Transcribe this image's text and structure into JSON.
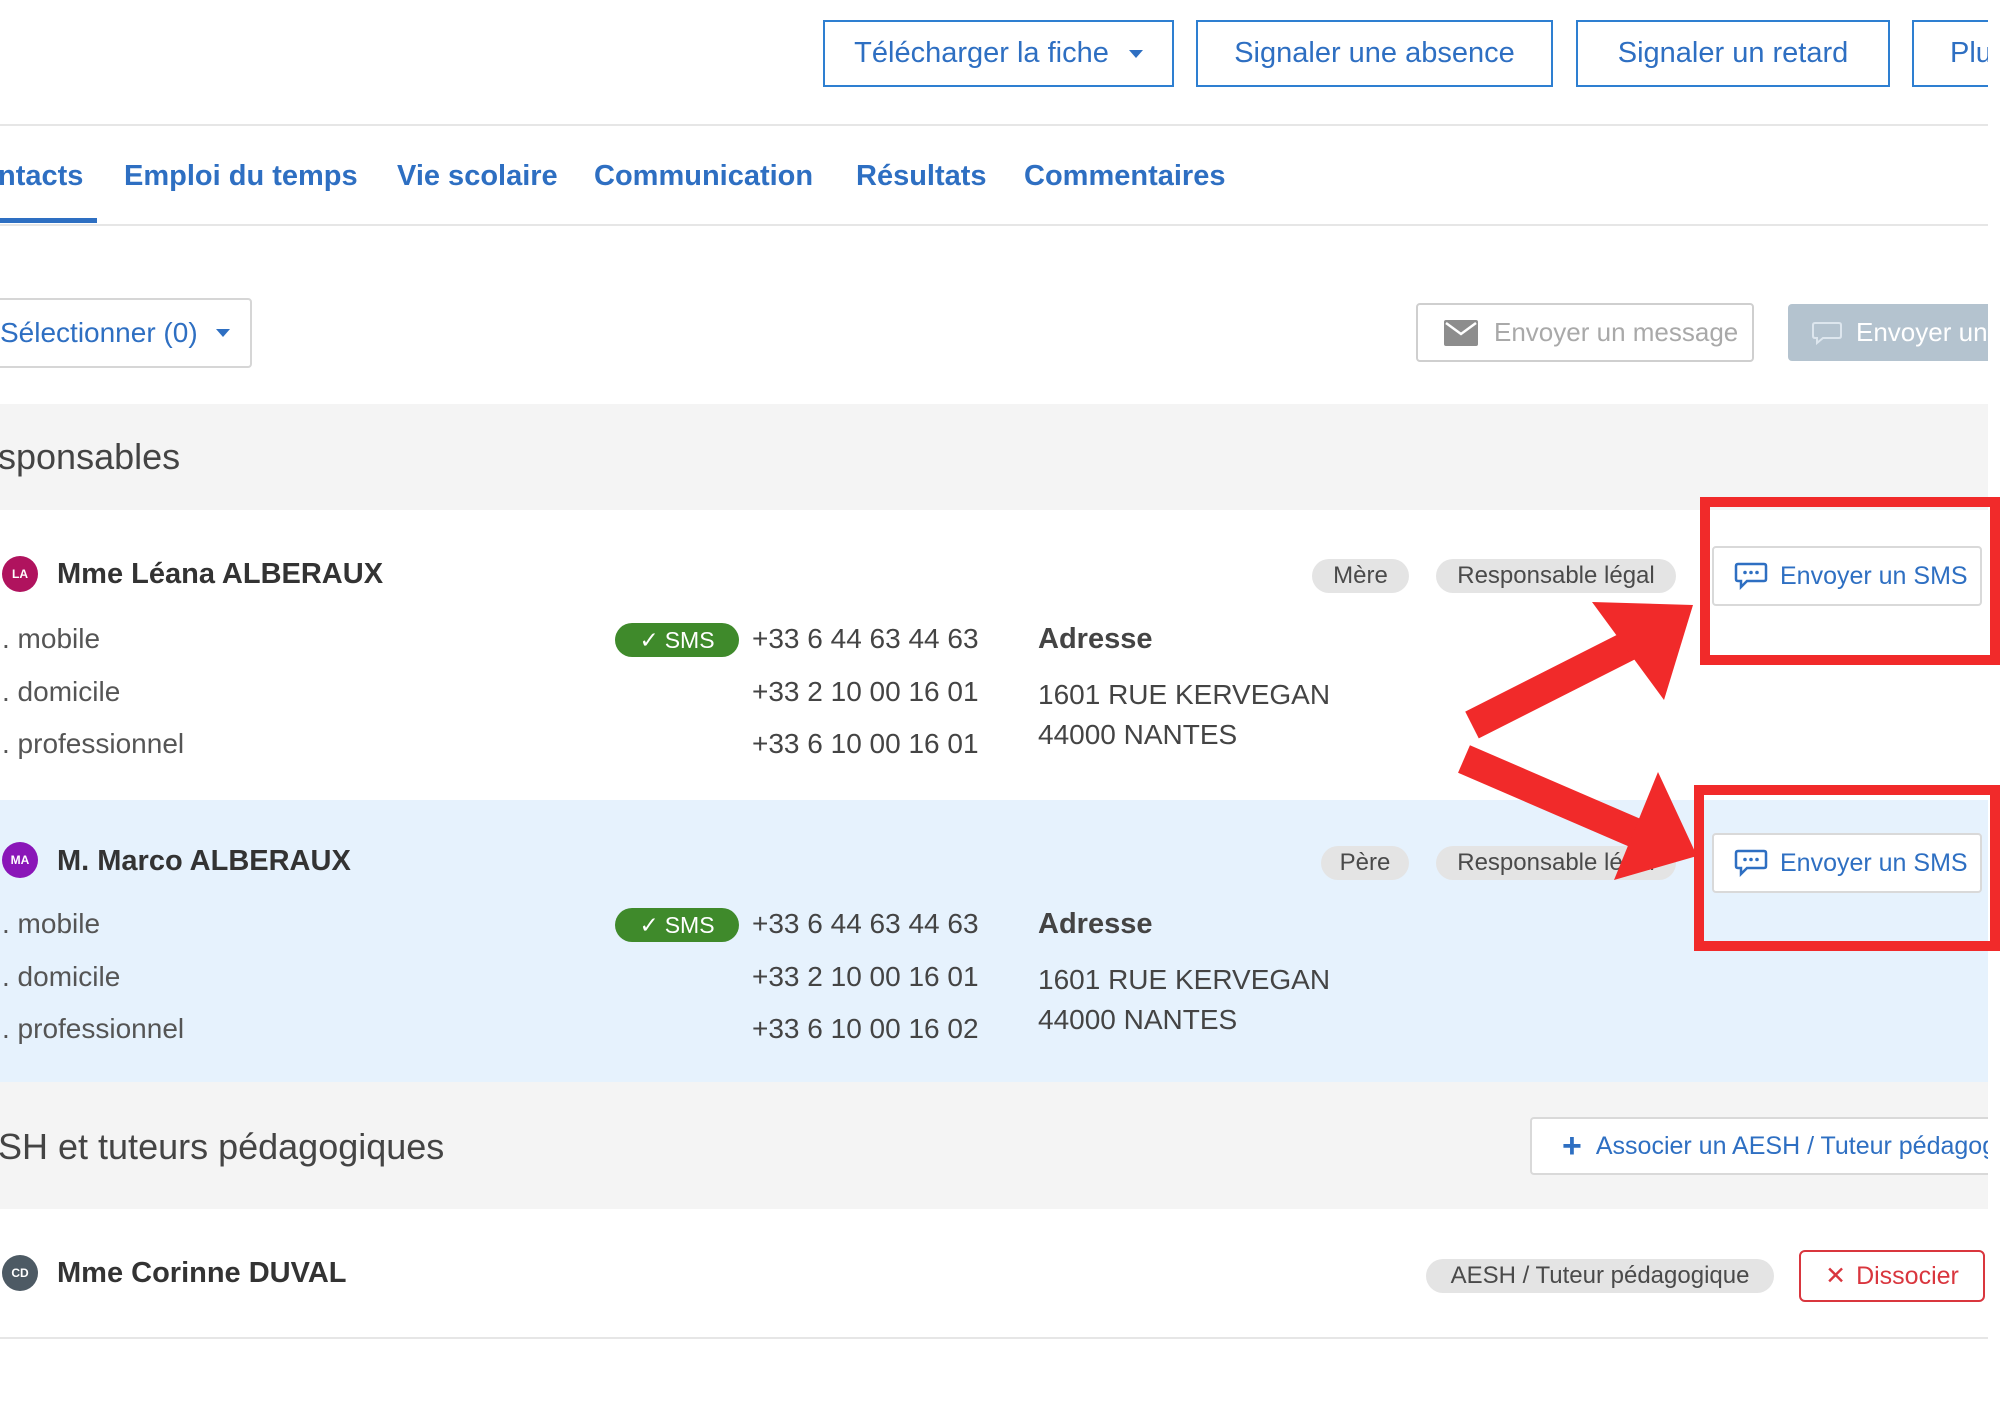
{
  "colors": {
    "accent": "#2e6fc2",
    "annotation": "#f12a2a",
    "sms_badge": "#3f8a2b",
    "danger": "#d9363e"
  },
  "header": {
    "download_label": "Télécharger la fiche",
    "absence_label": "Signaler une absence",
    "late_label": "Signaler un retard",
    "more_label": "Plu"
  },
  "tabs": [
    {
      "label": "ntacts",
      "active": true
    },
    {
      "label": "Emploi du temps"
    },
    {
      "label": "Vie scolaire"
    },
    {
      "label": "Communication"
    },
    {
      "label": "Résultats"
    },
    {
      "label": "Commentaires"
    }
  ],
  "toolbar": {
    "select_label": "Sélectionner (0)",
    "message_label": "Envoyer un message",
    "sms_bulk_label": "Envoyer un"
  },
  "responsables": {
    "title": "sponsables",
    "people": [
      {
        "initials": "LA",
        "avatar_color": "#b0135e",
        "name": "Mme Léana ALBERAUX",
        "relation": "Mère",
        "role": "Responsable légal",
        "sms_button": "Envoyer un SMS",
        "phones": [
          {
            "label": ". mobile",
            "number": "+33 6 44 63 44 63",
            "sms_badge": "SMS"
          },
          {
            "label": ". domicile",
            "number": "+33 2 10 00 16 01"
          },
          {
            "label": ". professionnel",
            "number": "+33 6 10 00 16 01"
          }
        ],
        "address_title": "Adresse",
        "address_lines": [
          "1601 RUE KERVEGAN",
          "44000 NANTES"
        ]
      },
      {
        "initials": "MA",
        "avatar_color": "#8a16b8",
        "name": "M. Marco ALBERAUX",
        "relation": "Père",
        "role": "Responsable légal",
        "sms_button": "Envoyer un SMS",
        "phones": [
          {
            "label": ". mobile",
            "number": "+33 6 44 63 44 63",
            "sms_badge": "SMS"
          },
          {
            "label": ". domicile",
            "number": "+33 2 10 00 16 01"
          },
          {
            "label": ". professionnel",
            "number": "+33 6 10 00 16 02"
          }
        ],
        "address_title": "Adresse",
        "address_lines": [
          "1601 RUE KERVEGAN",
          "44000 NANTES"
        ]
      }
    ]
  },
  "aesh": {
    "title": "SH et tuteurs pédagogiques",
    "associate_label": "Associer un AESH / Tuteur pédagog",
    "person": {
      "initials": "CD",
      "avatar_color": "#4d5a64",
      "name": "Mme Corinne DUVAL",
      "role": "AESH / Tuteur pédagogique",
      "dissociate_label": "Dissocier"
    }
  }
}
